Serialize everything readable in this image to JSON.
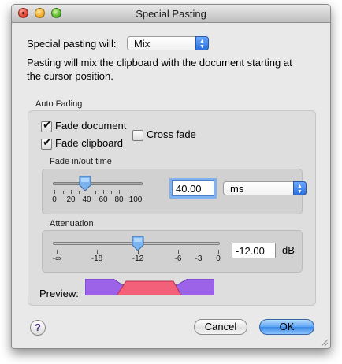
{
  "window": {
    "title": "Special Pasting"
  },
  "pasting_mode": {
    "label": "Special pasting will:",
    "selected": "Mix",
    "description_line1": "Pasting will mix the clipboard with the document starting at",
    "description_line2": "the cursor position."
  },
  "auto_fading": {
    "caption": "Auto Fading",
    "fade_document": {
      "label": "Fade document",
      "checked": true
    },
    "fade_clipboard": {
      "label": "Fade clipboard",
      "checked": true
    },
    "cross_fade": {
      "label": "Cross fade",
      "checked": false
    }
  },
  "fade_time": {
    "caption": "Fade in/out time",
    "value": "40.00",
    "unit_selected": "ms",
    "slider_value": 40,
    "ticks": [
      "0",
      "20",
      "40",
      "60",
      "80",
      "100"
    ]
  },
  "attenuation": {
    "caption": "Attenuation",
    "value": "-12.00",
    "unit": "dB",
    "slider_value": -12,
    "ticks": [
      "-∞",
      "-18",
      "-12",
      "-6",
      "-3",
      "0"
    ]
  },
  "preview": {
    "label": "Preview:",
    "document_color": "#9c63e8",
    "clipboard_color": "#f2607a"
  },
  "buttons": {
    "cancel": "Cancel",
    "ok": "OK",
    "help": "?"
  },
  "colors": {
    "accent_blue": "#3a88e6",
    "window_bg": "#e9e9e9"
  }
}
